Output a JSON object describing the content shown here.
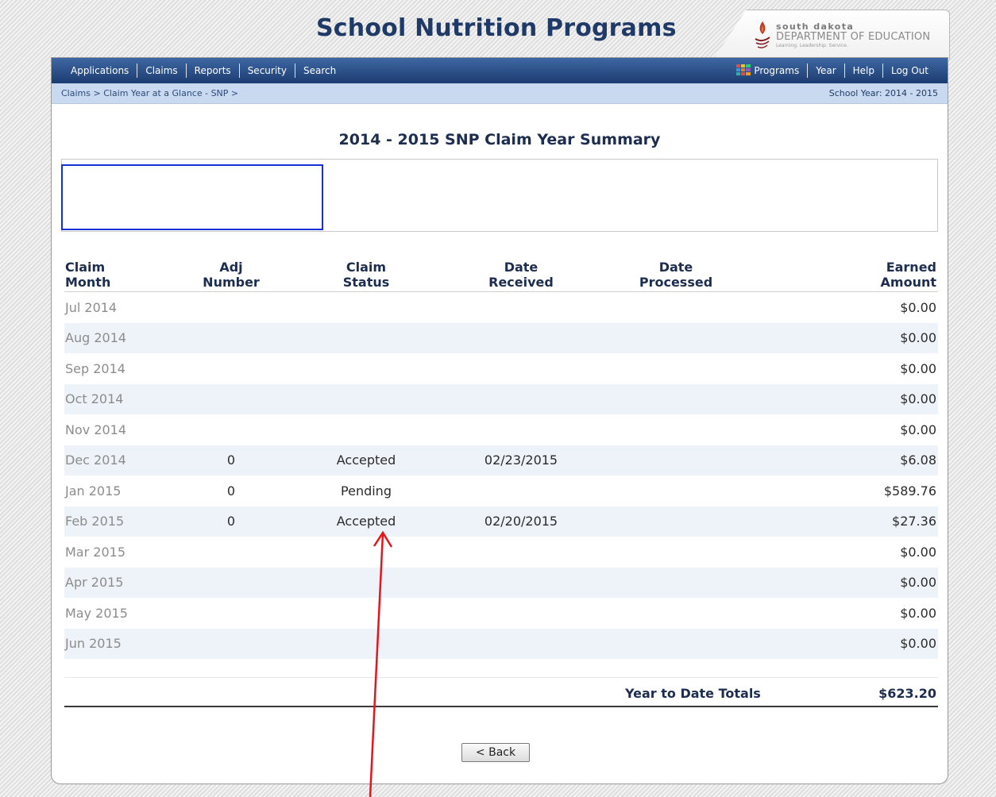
{
  "app": {
    "title": "School Nutrition Programs"
  },
  "logo": {
    "line1": "south dakota",
    "line2": "DEPARTMENT OF EDUCATION",
    "line3": "Learning. Leadership. Service."
  },
  "nav": {
    "left": [
      "Applications",
      "Claims",
      "Reports",
      "Security",
      "Search"
    ],
    "programs": "Programs",
    "right": [
      "Year",
      "Help",
      "Log Out"
    ]
  },
  "breadcrumb": {
    "path": "Claims > Claim Year at a Glance - SNP >",
    "school_year": "School Year: 2014 - 2015"
  },
  "page": {
    "title": "2014 - 2015 SNP Claim Year Summary"
  },
  "table": {
    "headers": [
      "Claim\nMonth",
      "Adj\nNumber",
      "Claim\nStatus",
      "Date\nReceived",
      "Date\nProcessed",
      "Earned\nAmount"
    ],
    "rows": [
      {
        "month": "Jul 2014",
        "adj": "",
        "status": "",
        "received": "",
        "processed": "",
        "amount": "$0.00"
      },
      {
        "month": "Aug 2014",
        "adj": "",
        "status": "",
        "received": "",
        "processed": "",
        "amount": "$0.00"
      },
      {
        "month": "Sep 2014",
        "adj": "",
        "status": "",
        "received": "",
        "processed": "",
        "amount": "$0.00"
      },
      {
        "month": "Oct 2014",
        "adj": "",
        "status": "",
        "received": "",
        "processed": "",
        "amount": "$0.00"
      },
      {
        "month": "Nov 2014",
        "adj": "",
        "status": "",
        "received": "",
        "processed": "",
        "amount": "$0.00"
      },
      {
        "month": "Dec 2014",
        "adj": "0",
        "status": "Accepted",
        "received": "02/23/2015",
        "processed": "",
        "amount": "$6.08"
      },
      {
        "month": "Jan 2015",
        "adj": "0",
        "status": "Pending",
        "received": "",
        "processed": "",
        "amount": "$589.76"
      },
      {
        "month": "Feb 2015",
        "adj": "0",
        "status": "Accepted",
        "received": "02/20/2015",
        "processed": "",
        "amount": "$27.36"
      },
      {
        "month": "Mar 2015",
        "adj": "",
        "status": "",
        "received": "",
        "processed": "",
        "amount": "$0.00"
      },
      {
        "month": "Apr 2015",
        "adj": "",
        "status": "",
        "received": "",
        "processed": "",
        "amount": "$0.00"
      },
      {
        "month": "May 2015",
        "adj": "",
        "status": "",
        "received": "",
        "processed": "",
        "amount": "$0.00"
      },
      {
        "month": "Jun 2015",
        "adj": "",
        "status": "",
        "received": "",
        "processed": "",
        "amount": "$0.00"
      }
    ],
    "totals_label": "Year to Date Totals",
    "totals_value": "$623.20"
  },
  "buttons": {
    "back": "< Back"
  },
  "colors": {
    "nav_top": "#3f67a3",
    "nav_bottom": "#1b3c71",
    "breadcrumb_bg": "#c9daf0",
    "title": "#1f3a66",
    "message_border": "#1a2fd6",
    "arrow": "#e8141b"
  },
  "icons": {
    "programs": "programs-grid-icon",
    "logo": "flame-torch-icon",
    "annotation": "red-arrow-pointer"
  }
}
